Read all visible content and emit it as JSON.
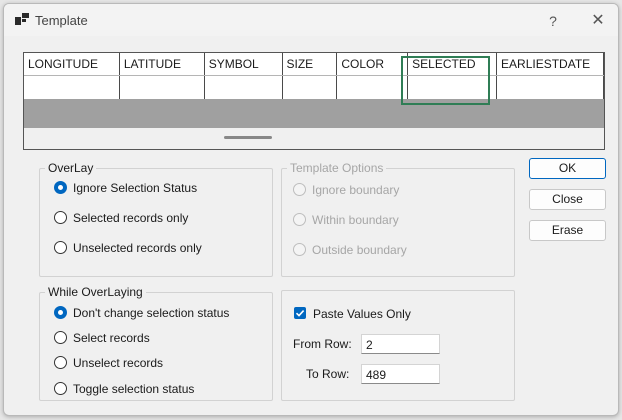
{
  "window": {
    "title": "Template",
    "help_glyph": "?",
    "close_glyph": "✕",
    "icon": "app-window-icon"
  },
  "grid": {
    "columns": [
      "LONGITUDE",
      "LATITUDE",
      "SYMBOL",
      "SIZE",
      "COLOR",
      "SELECTED",
      "EARLIESTDATE"
    ],
    "selected_column": "SELECTED"
  },
  "overlay": {
    "legend": "OverLay",
    "options": [
      "Ignore Selection Status",
      "Selected records only",
      "Unselected records only"
    ],
    "selected": "Ignore Selection Status"
  },
  "template_options": {
    "legend": "Template Options",
    "disabled": true,
    "options": [
      "Ignore boundary",
      "Within boundary",
      "Outside boundary"
    ],
    "selected": "Ignore boundary"
  },
  "while_overlaying": {
    "legend": "While OverLaying",
    "options": [
      "Don't change selection status",
      "Select records",
      "Unselect records",
      "Toggle selection status"
    ],
    "selected": "Don't change selection status"
  },
  "paste": {
    "paste_values_only_label": "Paste Values Only",
    "paste_values_only_checked": true,
    "from_row_label": "From Row:",
    "from_row_value": "2",
    "to_row_label": "To Row:",
    "to_row_value": "489"
  },
  "buttons": {
    "ok": "OK",
    "close": "Close",
    "erase": "Erase"
  },
  "colors": {
    "accent": "#0067c0",
    "selected_cell_border": "#2f7d55",
    "grid_empty_area": "#a0a0a0"
  }
}
